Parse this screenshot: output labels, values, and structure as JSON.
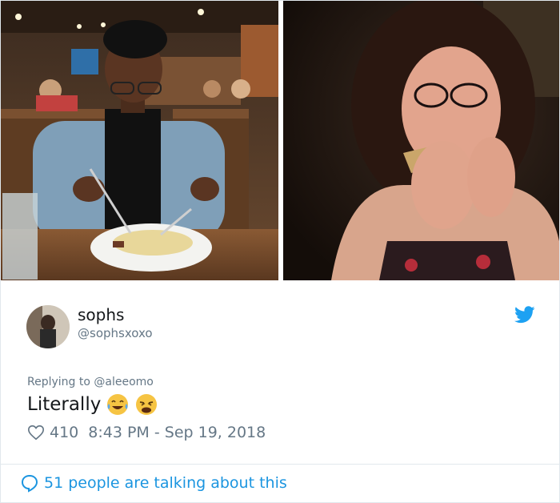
{
  "tweet": {
    "display_name": "sophs",
    "handle": "@sophsxoxo",
    "replying_to_prefix": "Replying to ",
    "replying_to_user": "@aleeomo",
    "text": "Literally",
    "emojis": [
      "face-with-tears-of-joy",
      "weary-face"
    ],
    "like_count": "410",
    "timestamp": "8:43 PM - Sep 19, 2018",
    "conversation": "51 people are talking about this"
  },
  "icons": {
    "twitter": "twitter-bird-icon",
    "like": "heart-outline-icon",
    "reply": "speech-bubble-icon"
  },
  "colors": {
    "brand_blue": "#1da1f2",
    "link_blue": "#1b95e0",
    "secondary_text": "#657786",
    "primary_text": "#14171a",
    "border": "#e1e8ed"
  }
}
